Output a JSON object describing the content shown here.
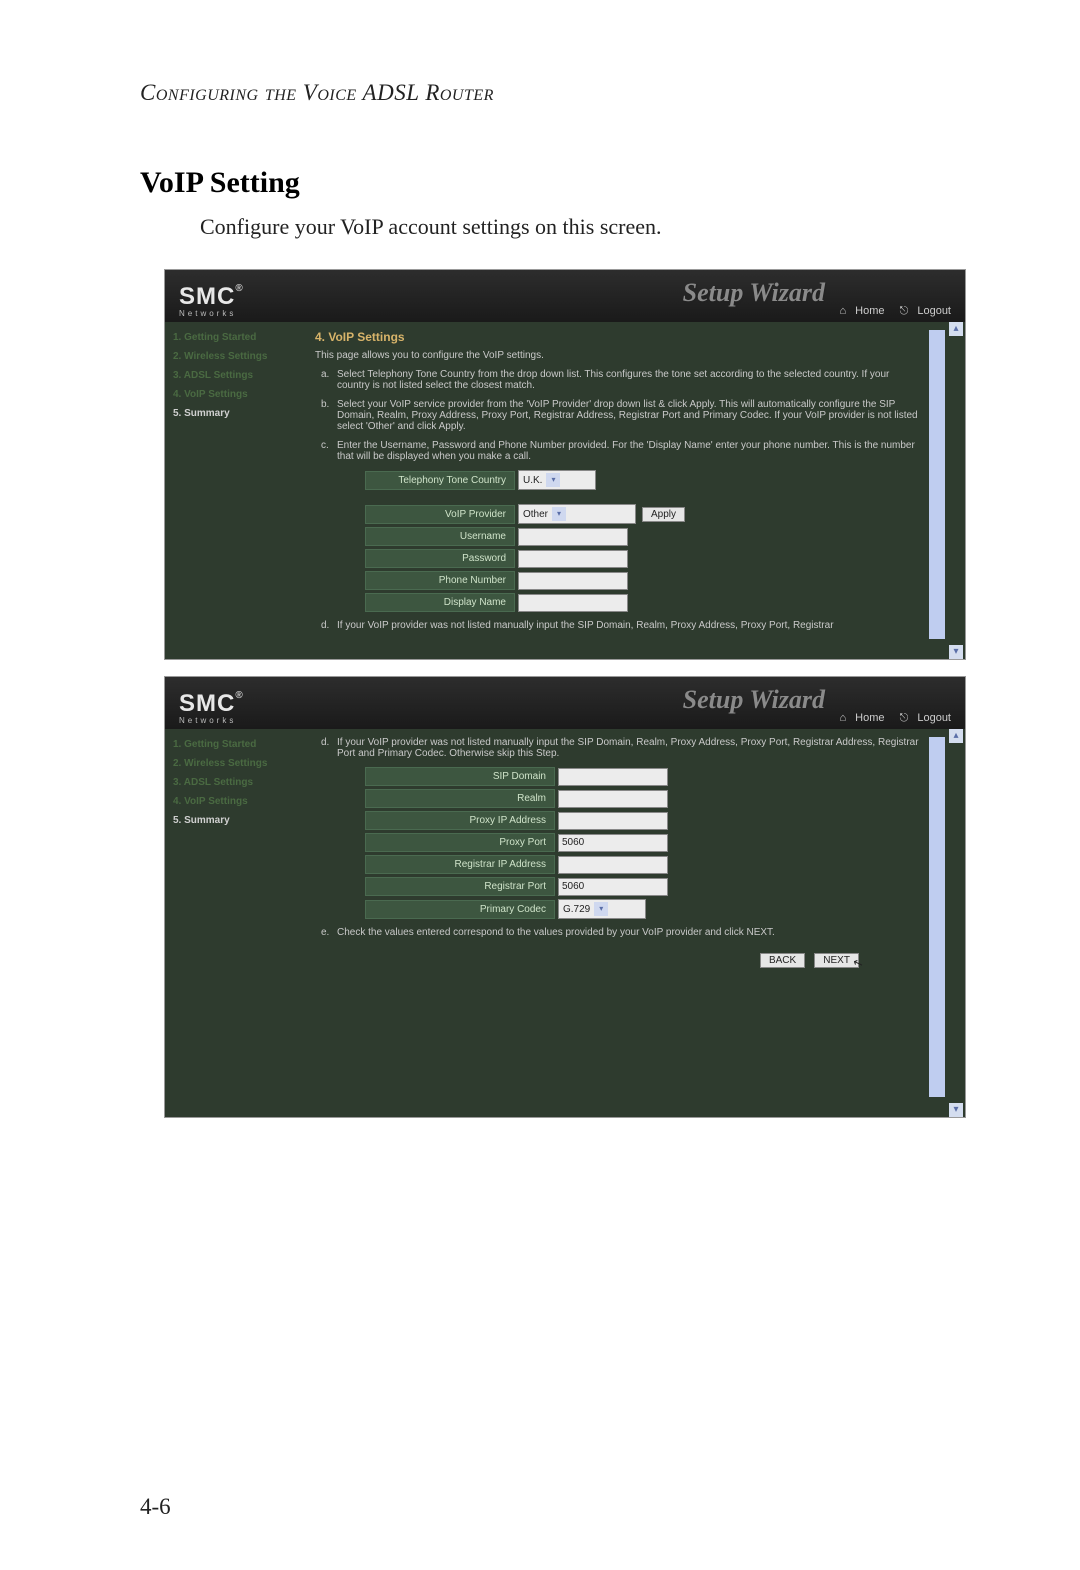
{
  "doc": {
    "section_header": "Configuring the Voice ADSL Router",
    "h2": "VoIP Setting",
    "body": "Configure your VoIP account settings on this screen.",
    "page_number": "4-6"
  },
  "shared": {
    "brand": "SMC",
    "brand_reg": "®",
    "brand_sub": "Networks",
    "wizard": "Setup Wizard",
    "home": "Home",
    "logout": "Logout",
    "home_icon": "⌂",
    "logout_icon": "⎋"
  },
  "shot1": {
    "sidebar": {
      "items": [
        {
          "label": "1. Getting Started",
          "cls": "dim"
        },
        {
          "label": "2. Wireless Settings",
          "cls": "dim"
        },
        {
          "label": "3. ADSL Settings",
          "cls": "dim"
        },
        {
          "label": "4. VoIP Settings",
          "cls": "dim"
        },
        {
          "label": "5. Summary",
          "cls": "active"
        }
      ]
    },
    "title": "4. VoIP Settings",
    "intro": "This page allows you to configure the VoIP settings.",
    "steps": {
      "a": "Select Telephony Tone Country from the drop down list. This configures the tone set according to the selected country. If your country is not listed select the closest match.",
      "b": "Select your VoIP service provider from the 'VoIP Provider' drop down list & click Apply. This will automatically configure the SIP Domain, Realm, Proxy Address, Proxy Port, Registrar Address, Registrar Port and Primary Codec. If your VoIP provider is not listed select 'Other' and click Apply.",
      "c": "Enter the Username, Password and Phone Number provided. For the 'Display Name' enter your phone number. This is the number that will be displayed when you make a call.",
      "d": "If your VoIP provider was not listed manually input the SIP Domain, Realm, Proxy Address, Proxy Port, Registrar"
    },
    "labels": {
      "tone_country": "Telephony Tone Country",
      "voip_provider": "VoIP Provider",
      "username": "Username",
      "password": "Password",
      "phone_number": "Phone Number",
      "display_name": "Display Name"
    },
    "values": {
      "tone_country": "U.K.",
      "voip_provider": "Other",
      "apply": "Apply"
    }
  },
  "shot2": {
    "sidebar": {
      "items": [
        {
          "label": "1. Getting Started",
          "cls": "dim"
        },
        {
          "label": "2. Wireless Settings",
          "cls": "dim"
        },
        {
          "label": "3. ADSL Settings",
          "cls": "dim"
        },
        {
          "label": "4. VoIP Settings",
          "cls": "dim"
        },
        {
          "label": "5. Summary",
          "cls": "active"
        }
      ]
    },
    "steps": {
      "d": "If your VoIP provider was not listed manually input the SIP Domain, Realm, Proxy Address, Proxy Port, Registrar Address, Registrar Port and Primary Codec. Otherwise skip this Step.",
      "e": "Check the values entered correspond to the values provided by your VoIP provider and click NEXT."
    },
    "labels": {
      "sip_domain": "SIP Domain",
      "realm": "Realm",
      "proxy_ip": "Proxy IP Address",
      "proxy_port": "Proxy Port",
      "registrar_ip": "Registrar IP Address",
      "registrar_port": "Registrar Port",
      "primary_codec": "Primary Codec"
    },
    "values": {
      "proxy_port": "5060",
      "registrar_port": "5060",
      "primary_codec": "G.729"
    },
    "nav": {
      "back": "BACK",
      "next": "NEXT"
    }
  }
}
